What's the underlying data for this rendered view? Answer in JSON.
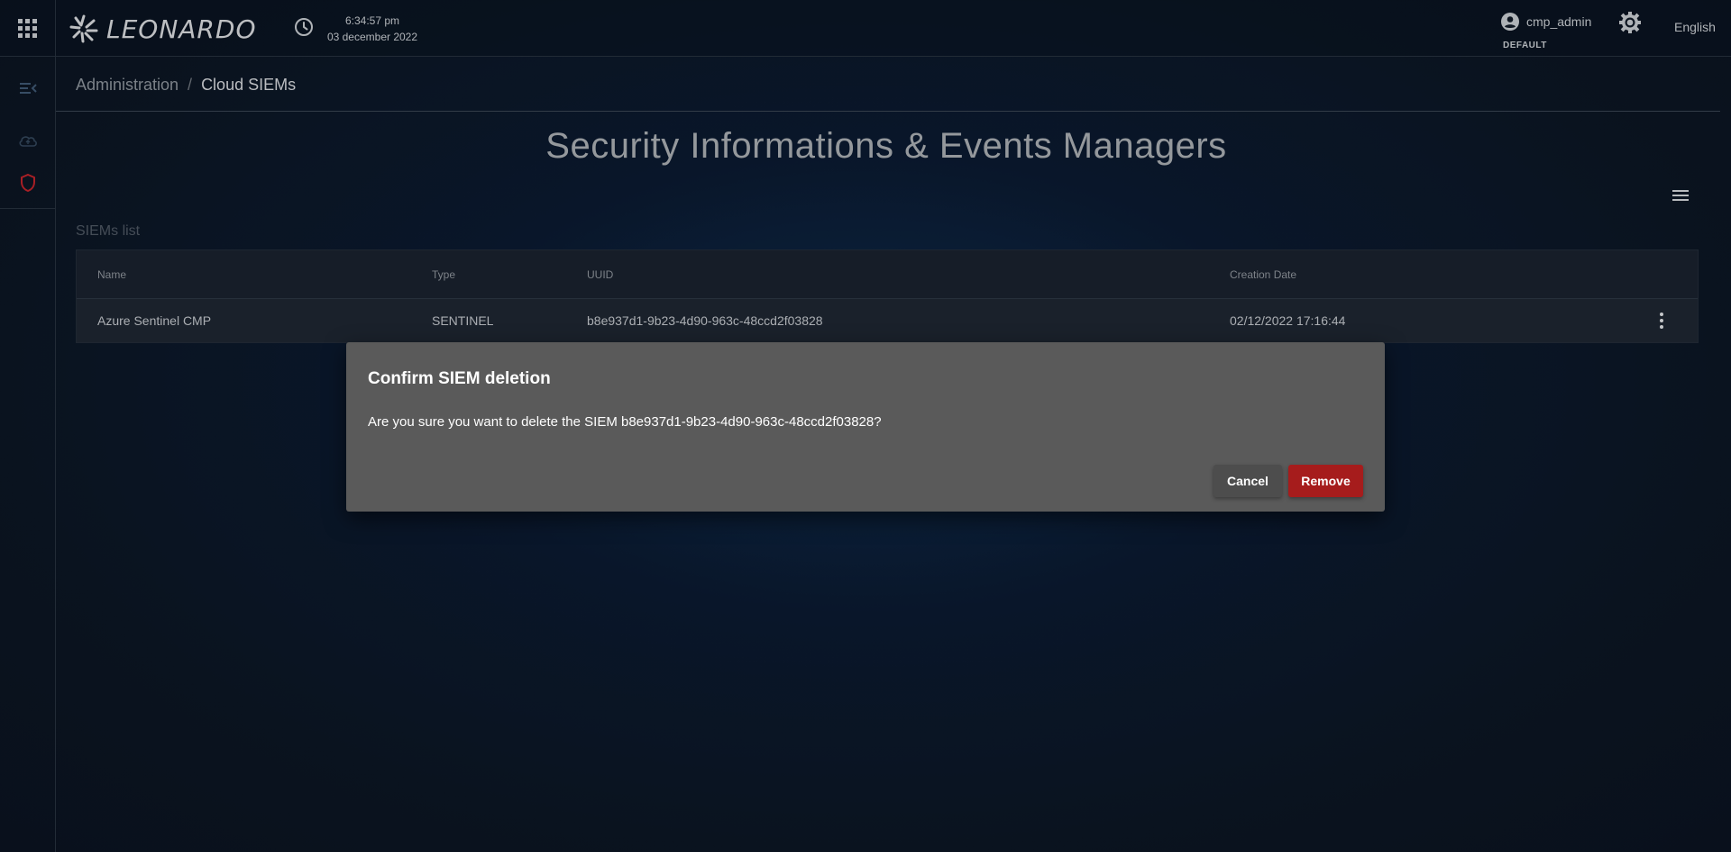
{
  "header": {
    "logo_text": "LEONARDO",
    "time": "6:34:57 pm",
    "date": "03 december 2022",
    "user_name": "cmp_admin",
    "user_role": "DEFAULT",
    "language": "English",
    "icons": [
      "apps-grid-icon",
      "leonardo-logo-icon",
      "clock-icon",
      "account-circle-icon",
      "brightness-icon"
    ]
  },
  "sidebar": {
    "items": [
      {
        "name": "collapse-menu-icon"
      },
      {
        "name": "cloud-upload-icon"
      },
      {
        "name": "shield-icon",
        "accent": "#c0242b"
      }
    ]
  },
  "breadcrumb": {
    "parent": "Administration",
    "separator": "/",
    "current": "Cloud SIEMs"
  },
  "page": {
    "title": "Security Informations & Events Managers",
    "list_label": "SIEMs list"
  },
  "table": {
    "headers": {
      "name": "Name",
      "type": "Type",
      "uuid": "UUID",
      "creation_date": "Creation Date"
    },
    "rows": [
      {
        "name": "Azure Sentinel CMP",
        "type": "SENTINEL",
        "uuid": "b8e937d1-9b23-4d90-963c-48ccd2f03828",
        "creation_date": "02/12/2022 17:16:44"
      }
    ]
  },
  "dialog": {
    "title": "Confirm SIEM deletion",
    "message": "Are you sure you want to delete the SIEM b8e937d1-9b23-4d90-963c-48ccd2f03828?",
    "cancel_label": "Cancel",
    "remove_label": "Remove",
    "remove_color": "#a61c1c"
  }
}
